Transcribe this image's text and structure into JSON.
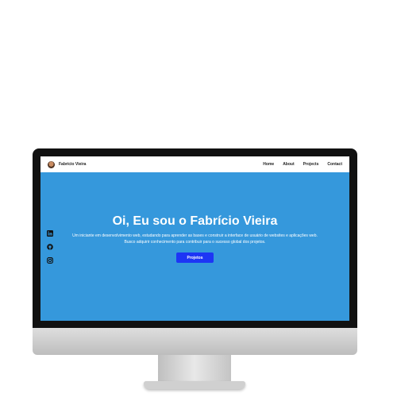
{
  "header": {
    "brand": "Fabrício Vieira",
    "nav": [
      "Home",
      "About",
      "Projects",
      "Contact"
    ]
  },
  "social": [
    "linkedin-icon",
    "github-icon",
    "instagram-icon"
  ],
  "hero": {
    "title": "Oi, Eu sou o Fabrício Vieira",
    "line1": "Um iniciante em desenvolvimento web, estudando para aprender as bases e construir a interface de usuário de websites e aplicações web.",
    "line2": "Busco adquirir conhecimento para contribuir para o sucesso global dos projetos.",
    "button": "Projetos"
  },
  "colors": {
    "hero_bg": "#3598dc",
    "button_bg": "#1d35f5",
    "monitor_frame": "#111111"
  }
}
